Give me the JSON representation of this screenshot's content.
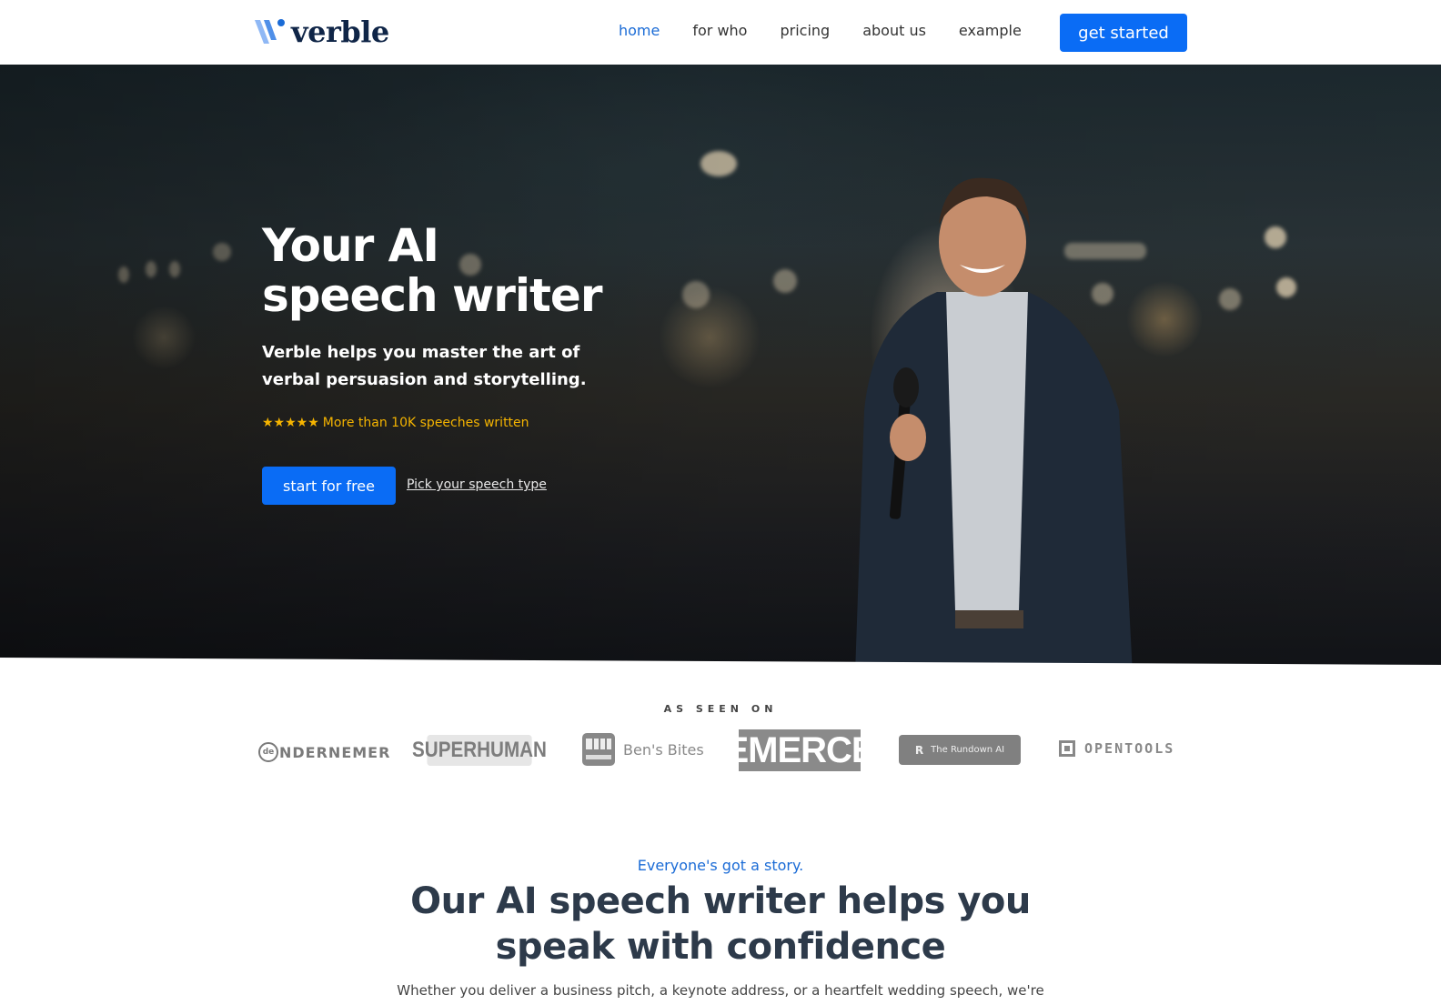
{
  "nav": {
    "logo_text": "verble",
    "links": [
      {
        "label": "home",
        "active": true
      },
      {
        "label": "for who",
        "active": false
      },
      {
        "label": "pricing",
        "active": false
      },
      {
        "label": "about us",
        "active": false
      },
      {
        "label": "example",
        "active": false
      }
    ],
    "cta_label": "get started"
  },
  "hero": {
    "title_line1": "Your AI",
    "title_line2": "speech writer",
    "subtitle": "Verble helps you master the art of verbal persuasion and storytelling.",
    "rating_stars": "★★★★★",
    "rating_text": "More than 10K speeches written",
    "primary_button": "start for free",
    "secondary_link": "Pick your speech type",
    "image_icon": "speaker-with-microphone-photo"
  },
  "press": {
    "label": "AS SEEN ON",
    "logos": [
      {
        "name": "De Ondernemer",
        "mark": "de",
        "text": "NDERNEMER"
      },
      {
        "name": "Superhuman",
        "text": "SUPERHUMAN"
      },
      {
        "name": "Ben's Bites",
        "text": "Ben's Bites"
      },
      {
        "name": "Emerce",
        "text": "EMERCE"
      },
      {
        "name": "The Rundown AI",
        "mark": "R",
        "text": "The Rundown AI"
      },
      {
        "name": "OpenTools",
        "text": "OPENTOOLS"
      }
    ]
  },
  "story": {
    "kicker": "Everyone's got a story.",
    "title": "Our AI speech writer helps you speak with confidence",
    "body": "Whether you deliver a business pitch, a keynote address, or a heartfelt wedding speech, we're"
  },
  "colors": {
    "accent": "#0a6cf5",
    "nav_active": "#1a6bd6",
    "rating": "#f5b400",
    "heading": "#2d3a4a",
    "logo_dark": "#0f2547"
  }
}
